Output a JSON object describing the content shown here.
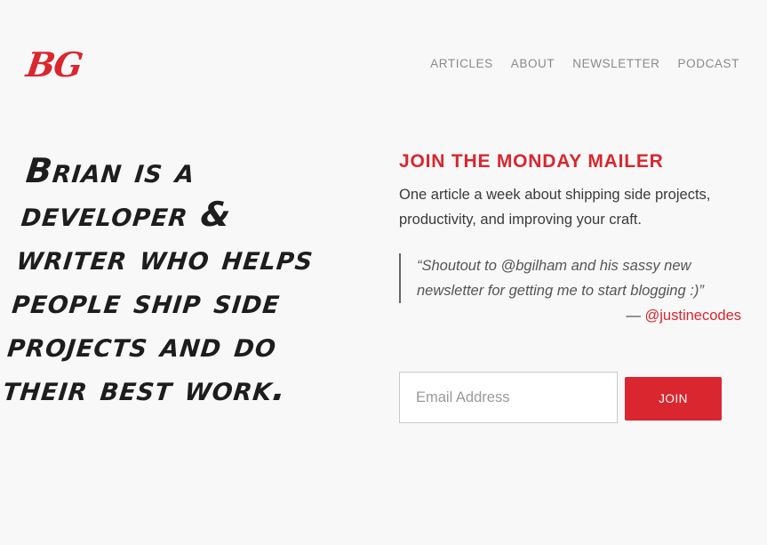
{
  "header": {
    "logo": "BG",
    "nav": [
      {
        "label": "ARTICLES"
      },
      {
        "label": "ABOUT"
      },
      {
        "label": "NEWSLETTER"
      },
      {
        "label": "PODCAST"
      }
    ]
  },
  "hero": {
    "text": "Brian is a developer & writer who helps people ship side projects and do their best work."
  },
  "mailer": {
    "heading": "JOIN THE MONDAY MAILER",
    "description": "One article a week about shipping side projects, productivity, and improving your craft.",
    "quote": "“Shoutout to @bgilham and his sassy new newsletter for getting me to start blogging :)”",
    "attribution_prefix": "— ",
    "attribution_handle": "@justinecodes",
    "email_placeholder": "Email Address",
    "join_label": "JOIN"
  },
  "colors": {
    "accent": "#d9262f",
    "background": "#f8f8f8",
    "nav_text": "#8a8a8a"
  }
}
